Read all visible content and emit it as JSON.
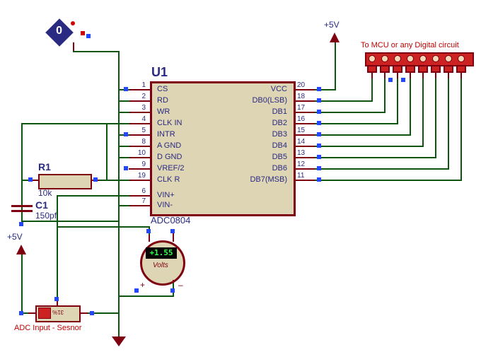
{
  "ic": {
    "ref": "U1",
    "value": "ADC0804",
    "left_pins": [
      {
        "num": "1",
        "name": "CS"
      },
      {
        "num": "2",
        "name": "RD"
      },
      {
        "num": "3",
        "name": "WR"
      },
      {
        "num": "4",
        "name": "CLK IN"
      },
      {
        "num": "5",
        "name": "INTR"
      },
      {
        "num": "8",
        "name": "A GND"
      },
      {
        "num": "10",
        "name": "D GND"
      },
      {
        "num": "9",
        "name": "VREF/2"
      },
      {
        "num": "19",
        "name": "CLK R"
      }
    ],
    "right_pins": [
      {
        "num": "20",
        "name": "VCC"
      },
      {
        "num": "18",
        "name": "DB0(LSB)"
      },
      {
        "num": "17",
        "name": "DB1"
      },
      {
        "num": "16",
        "name": "DB2"
      },
      {
        "num": "15",
        "name": "DB3"
      },
      {
        "num": "14",
        "name": "DB4"
      },
      {
        "num": "13",
        "name": "DB5"
      },
      {
        "num": "12",
        "name": "DB6"
      },
      {
        "num": "11",
        "name": "DB7(MSB)"
      }
    ],
    "bottom_pins": [
      {
        "num": "6",
        "name": "VIN+"
      },
      {
        "num": "7",
        "name": "VIN-"
      }
    ]
  },
  "resistor": {
    "ref": "R1",
    "value": "10k"
  },
  "capacitor": {
    "ref": "C1",
    "value": "150pf"
  },
  "power1": {
    "label": "+5V"
  },
  "power2": {
    "label": "+5V"
  },
  "meter": {
    "reading": "+1.55",
    "caption": "Volts",
    "plus": "+",
    "minus": "–"
  },
  "diamond": {
    "value": "0"
  },
  "connector": {
    "title": "To MCU or any Digital circuit"
  },
  "pot": {
    "label": "ADC Input - Sesnor",
    "pct": "31%"
  },
  "gnd": {}
}
